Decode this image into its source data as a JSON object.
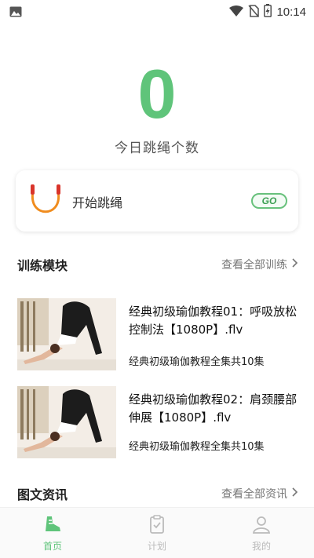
{
  "status_bar": {
    "time": "10:14"
  },
  "counter": {
    "value": "0",
    "label": "今日跳绳个数"
  },
  "start_card": {
    "label": "开始跳绳",
    "go_label": "GO"
  },
  "training": {
    "title": "训练模块",
    "more": "查看全部训练",
    "items": [
      {
        "title": "经典初级瑜伽教程01：呼吸放松控制法【1080P】.flv",
        "subtitle": "经典初级瑜伽教程全集共10集"
      },
      {
        "title": "经典初级瑜伽教程02：肩颈腰部伸展【1080P】.flv",
        "subtitle": "经典初级瑜伽教程全集共10集"
      }
    ]
  },
  "news": {
    "title": "图文资讯",
    "more": "查看全部资讯"
  },
  "tabbar": {
    "items": [
      {
        "label": "首页",
        "active": true
      },
      {
        "label": "计划",
        "active": false
      },
      {
        "label": "我的",
        "active": false
      }
    ]
  },
  "colors": {
    "accent": "#5fc47a",
    "accent_dark": "#3d9f54",
    "inactive": "#bbbbbb",
    "rope_orange": "#f08c1e",
    "rope_red": "#d9342b"
  }
}
